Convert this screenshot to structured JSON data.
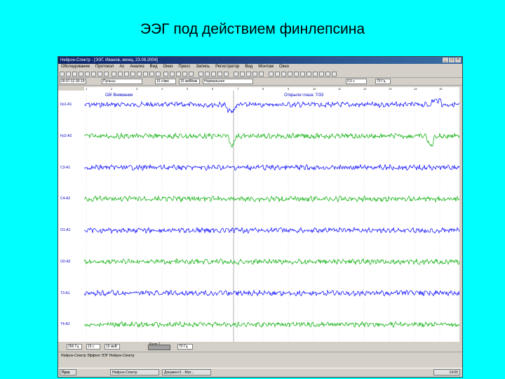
{
  "slide": {
    "title": "ЭЭГ под действием финлепсина"
  },
  "window": {
    "title": "Нейрон-Спектр - [ЭЭГ, Иванов, женщ, 23.08.2004]",
    "menu": [
      "Обследование",
      "Протокол",
      "Ас",
      "Анализ",
      "Вид",
      "Окно",
      "Пресс",
      "Запись",
      "Регистратор",
      "Вид",
      "Монтаж",
      "Окно"
    ],
    "toolbar2": {
      "montage": "Пульсы",
      "speed": "15 с/мм",
      "sens": "15 мкВ/мм",
      "filter": "0.5 с",
      "filter2": "70 Гц"
    },
    "toolbar3": {
      "time": "00:07:12  00:19:20",
      "mode": "Нормальное"
    },
    "ruler_ticks": [
      "1",
      "2",
      "3",
      "4",
      "5",
      "6",
      "7",
      "8",
      "9",
      "10",
      "11",
      "12",
      "13",
      "14",
      "15"
    ],
    "annotations": [
      "Ой! Внимание",
      "Открыли глаза: 7/33"
    ],
    "channels": [
      "Fp1-A1",
      "Fp2-A2",
      "C3-A1",
      "C4-A2",
      "O1-A1",
      "O2-A2",
      "T3-A1",
      "T4-A2"
    ],
    "channel_colors": [
      "#0000ff",
      "#00aa00",
      "#0000ff",
      "#00aa00",
      "#0000ff",
      "#00aa00",
      "#0000ff",
      "#00aa00"
    ],
    "status": {
      "page": "256 Гц",
      "sens": "15 с",
      "speed": "15 мкВ",
      "filt": "70 Гц",
      "frame": "Кадр 1"
    },
    "status2": "Нейрон-Спектр   Эффект  ЭЭГ  Нейрон-Спектр",
    "taskbar": {
      "start": "Пуск",
      "tasks": [
        "Нейрон-Спектр",
        "Документ1 - Micr..."
      ],
      "clock": "14:05"
    }
  }
}
